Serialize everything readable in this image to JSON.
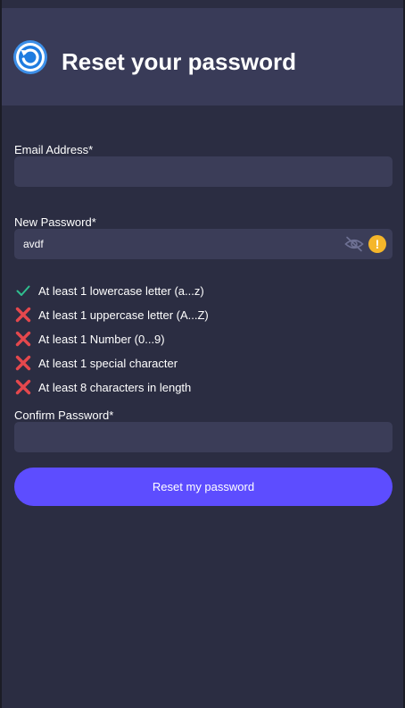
{
  "header": {
    "title": "Reset your password",
    "logo_icon": "circular-arrow-icon"
  },
  "form": {
    "email": {
      "label": "Email Address*",
      "value": ""
    },
    "new_password": {
      "label": "New Password*",
      "value": "avdf",
      "toggle_icon": "eye-slash-icon",
      "status_icon": "warning-icon",
      "status_glyph": "!"
    },
    "requirements": [
      {
        "text": "At least 1 lowercase letter (a...z)",
        "met": true,
        "icon": "check-icon"
      },
      {
        "text": "At least 1 uppercase letter (A...Z)",
        "met": false,
        "icon": "cross-icon"
      },
      {
        "text": "At least 1 Number (0...9)",
        "met": false,
        "icon": "cross-icon"
      },
      {
        "text": "At least 1 special character",
        "met": false,
        "icon": "cross-icon"
      },
      {
        "text": "At least 8 characters in length",
        "met": false,
        "icon": "cross-icon"
      }
    ],
    "confirm_password": {
      "label": "Confirm Password*",
      "value": ""
    },
    "submit_label": "Reset my password"
  },
  "colors": {
    "background": "#2b2d42",
    "header": "#393b58",
    "field": "#3b3d58",
    "accent": "#5d4dff",
    "success": "#2fbf8f",
    "error": "#e5484d",
    "warning": "#f5b62a"
  }
}
